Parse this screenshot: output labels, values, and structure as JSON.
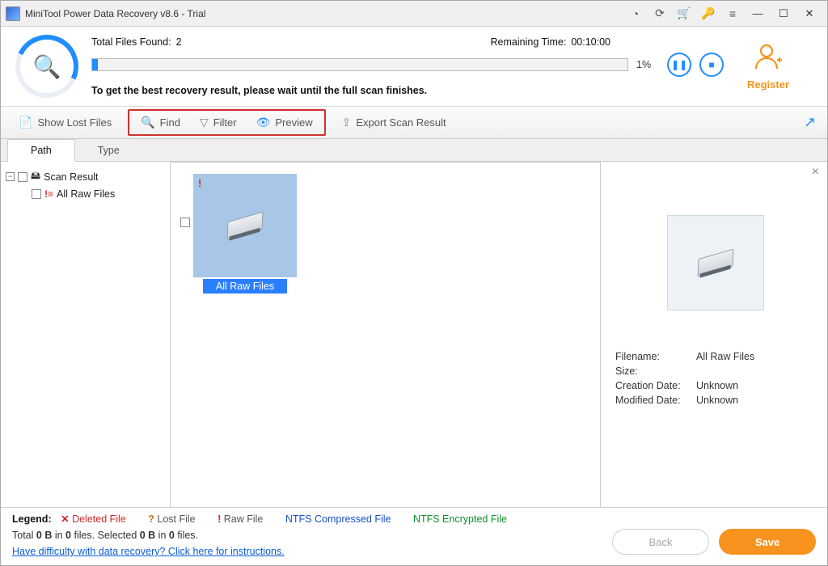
{
  "title": "MiniTool Power Data Recovery v8.6 - Trial",
  "progress": {
    "found_label": "Total Files Found:",
    "found_value": "2",
    "remaining_label": "Remaining Time:",
    "remaining_value": "00:10:00",
    "percent": "1%",
    "hint": "To get the best recovery result, please wait until the full scan finishes."
  },
  "register": {
    "label": "Register"
  },
  "toolbar": {
    "show_lost": "Show Lost Files",
    "find": "Find",
    "filter": "Filter",
    "preview": "Preview",
    "export": "Export Scan Result"
  },
  "tabs": {
    "path": "Path",
    "type": "Type"
  },
  "tree": {
    "root": "Scan Result",
    "child": "All Raw Files"
  },
  "thumb": {
    "label": "All Raw Files"
  },
  "meta": {
    "filename_k": "Filename:",
    "filename_v": "All Raw Files",
    "size_k": "Size:",
    "size_v": "",
    "created_k": "Creation Date:",
    "created_v": "Unknown",
    "modified_k": "Modified Date:",
    "modified_v": "Unknown"
  },
  "legend": {
    "title": "Legend:",
    "deleted": "Deleted File",
    "lost": "Lost File",
    "raw": "Raw File",
    "ntfs_c": "NTFS Compressed File",
    "ntfs_e": "NTFS Encrypted File"
  },
  "totals": {
    "prefix": "Total ",
    "tbytes": "0 B",
    "tmid": " in ",
    "tfiles": "0",
    "tsfx": " files.   Selected ",
    "sbytes": "0 B",
    "smid": " in ",
    "sfiles": "0",
    "ssfx": " files."
  },
  "help_link": "Have difficulty with data recovery? Click here for instructions.",
  "buttons": {
    "back": "Back",
    "save": "Save"
  }
}
